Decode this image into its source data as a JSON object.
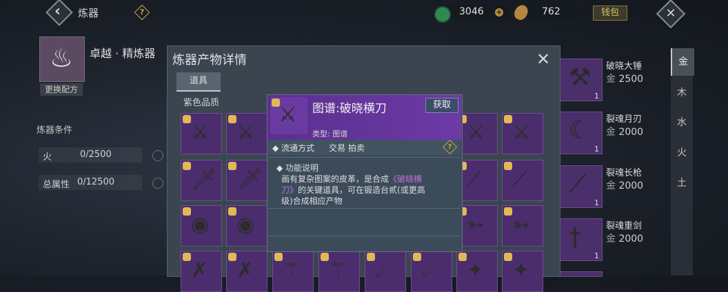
{
  "header": {
    "title": "炼器",
    "help_icon": "?",
    "currency1": {
      "icon": "jade-coin-icon",
      "value": "3046"
    },
    "plus_label": "+",
    "currency2": {
      "icon": "gold-leaf-icon",
      "value": "762"
    },
    "wallet_label": "钱包"
  },
  "recipe": {
    "name": "卓越 · 精炼器",
    "change_label": "更换配方",
    "conditions_title": "炼器条件",
    "conditions": [
      {
        "label": "火",
        "value": "0/2500"
      },
      {
        "label": "总属性",
        "value": "0/12500"
      }
    ]
  },
  "dialog": {
    "title": "炼器产物详情",
    "tab_label": "道具",
    "quality_label": "紫色品质",
    "grid_rows": [
      [
        "blade",
        "blade",
        "",
        "",
        "",
        "",
        "blade",
        "blade"
      ],
      [
        "sword",
        "sword",
        "",
        "",
        "",
        "",
        "spear",
        "spear"
      ],
      [
        "shield",
        "shield",
        "",
        "",
        "",
        "",
        "arrows",
        "arrows"
      ],
      [
        "crossbow",
        "crossbow",
        "staff",
        "staff",
        "flail",
        "flail",
        "shuriken",
        "shuriken"
      ]
    ]
  },
  "tooltip": {
    "title": "图谱:破晓横刀",
    "obtain_label": "获取",
    "type_text": "类型: 图谱",
    "circulation_label": "流通方式",
    "circulation_value": "交易 拍卖",
    "function_label": "功能说明",
    "desc_line1_prefix": "画有复杂图案的皮革，是合成",
    "desc_link1": "《破晓横",
    "desc_link2": "刀》",
    "desc_line2_suffix": "的关键道具，可在锻造台贰(或更高",
    "desc_line3": "级)合成相应产物"
  },
  "product_list": [
    {
      "name": "破晓大锤",
      "price_prefix": "金",
      "price": "2500",
      "qty": "1",
      "icon": "hammer-icon"
    },
    {
      "name": "裂魂月刃",
      "price_prefix": "金",
      "price": "2000",
      "qty": "1",
      "icon": "crescent-blade-icon"
    },
    {
      "name": "裂魂长枪",
      "price_prefix": "金",
      "price": "2000",
      "qty": "1",
      "icon": "spear-icon"
    },
    {
      "name": "裂魂重剑",
      "price_prefix": "金",
      "price": "2000",
      "qty": "1",
      "icon": "greatsword-icon"
    }
  ],
  "element_tabs": [
    "金",
    "木",
    "水",
    "火",
    "土"
  ],
  "colors": {
    "purple_quality": "#4b2d6d",
    "accent_gold": "#c9a93a",
    "link_purple": "#c070e0"
  }
}
